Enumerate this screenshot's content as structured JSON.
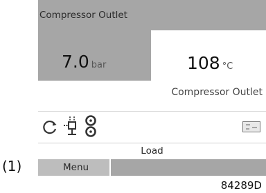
{
  "display": {
    "top_label": "Compressor Outlet",
    "bottom_label": "Compressor Outlet",
    "left_value": {
      "number": "7.0",
      "unit": "bar"
    },
    "right_value": {
      "number": "108",
      "unit": "°C"
    }
  },
  "icons": [
    "motor-rotation-icon",
    "drain-valve-icon",
    "service-timer-icon",
    "communication-card-icon"
  ],
  "status": {
    "text": "Load"
  },
  "menu": {
    "label": "Menu"
  },
  "callout": {
    "label": "(1)"
  },
  "figure": {
    "code": "84289D"
  },
  "colors": {
    "panel_gray": "#a6a6a6",
    "menu_button": "#bdbdbd"
  }
}
